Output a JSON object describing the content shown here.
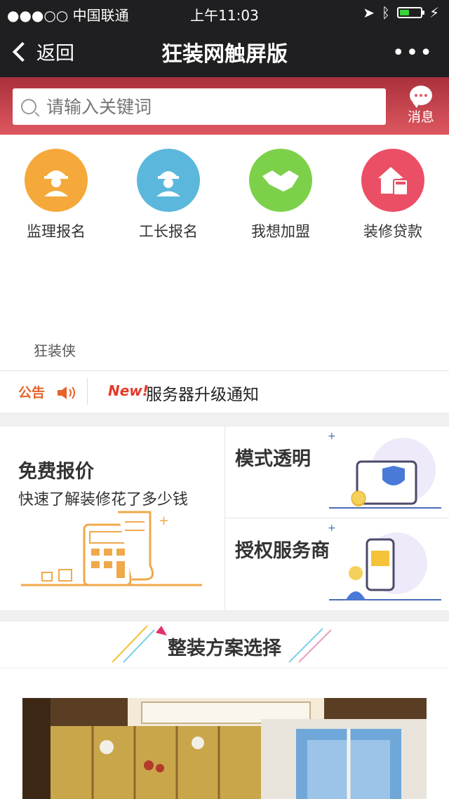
{
  "status": {
    "carrier": "●●●○○ 中国联通",
    "time": "上午11:03",
    "battery_level": 0.45
  },
  "nav": {
    "back_label": "返回",
    "title": "狂装网触屏版",
    "more": "•••"
  },
  "search": {
    "placeholder": "请输入关键词",
    "message_label": "消息"
  },
  "quick_links": [
    {
      "label": "监理报名",
      "icon": "supervisor-helmet-icon",
      "color": "#f5a93a"
    },
    {
      "label": "工长报名",
      "icon": "foreman-worker-icon",
      "color": "#5bb8dc"
    },
    {
      "label": "我想加盟",
      "icon": "handshake-icon",
      "color": "#7dd14a"
    },
    {
      "label": "装修贷款",
      "icon": "house-calculator-icon",
      "color": "#eb4f66"
    }
  ],
  "brand": "狂装侠",
  "notice": {
    "tag": "公告",
    "new": "New!",
    "text": "服务器升级通知"
  },
  "promo": {
    "left_title": "免费报价",
    "left_subtitle": "快速了解装修花了多少钱",
    "right_top": "模式透明",
    "right_bottom": "授权服务商"
  },
  "plans": {
    "title": "整装方案选择"
  }
}
